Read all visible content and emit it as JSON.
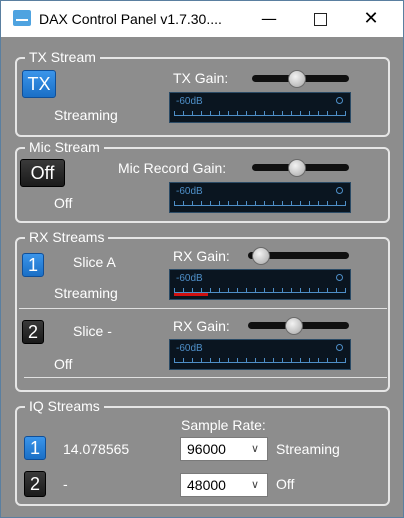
{
  "window": {
    "title": "DAX Control Panel v1.7.30...."
  },
  "tx": {
    "group_title": "TX Stream",
    "button_label": "TX",
    "gain_label": "TX Gain:",
    "gain_value": 0.45,
    "status": "Streaming",
    "meter_label": "-60dB"
  },
  "mic": {
    "group_title": "Mic Stream",
    "button_label": "Off",
    "gain_label": "Mic Record Gain:",
    "gain_value": 0.45,
    "status": "Off",
    "meter_label": "-60dB"
  },
  "rx": {
    "group_title": "RX Streams",
    "streams": [
      {
        "number": "1",
        "slice_label": "Slice A",
        "gain_label": "RX Gain:",
        "gain_value": 0.05,
        "status": "Streaming",
        "meter_label": "-60dB",
        "level": 0.2
      },
      {
        "number": "2",
        "slice_label": "Slice -",
        "gain_label": "RX Gain:",
        "gain_value": 0.45,
        "status": "Off",
        "meter_label": "-60dB",
        "level": 0
      }
    ]
  },
  "iq": {
    "group_title": "IQ Streams",
    "sample_rate_label": "Sample Rate:",
    "streams": [
      {
        "number": "1",
        "frequency": "14.078565",
        "sample_rate": "96000",
        "status": "Streaming"
      },
      {
        "number": "2",
        "frequency": "-",
        "sample_rate": "48000",
        "status": "Off"
      }
    ]
  },
  "colors": {
    "accent": "#1a6fc6",
    "panel": "#8d8d8d",
    "meter_bg": "#0a1520",
    "meter_blue": "#4e8fc8",
    "level_red": "#d01010"
  },
  "icons": {
    "app": "dax-app-icon",
    "minimize": "minimize-icon",
    "maximize": "maximize-icon",
    "close": "close-icon",
    "dropdown": "chevron-down-icon"
  }
}
